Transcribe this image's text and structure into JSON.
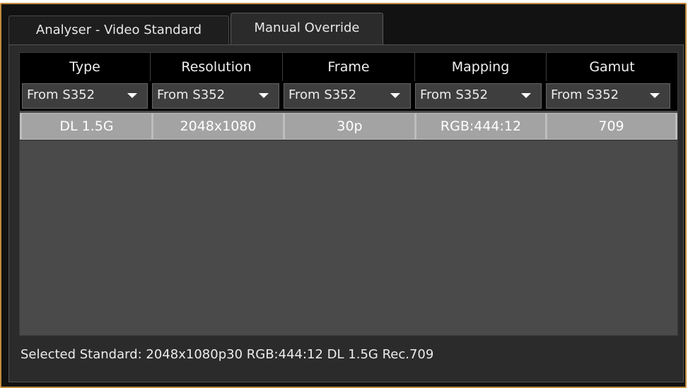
{
  "tabs": [
    {
      "label": "Analyser - Video Standard",
      "active": false
    },
    {
      "label": "Manual Override",
      "active": true
    }
  ],
  "table": {
    "columns": [
      "Type",
      "Resolution",
      "Frame",
      "Mapping",
      "Gamut"
    ],
    "dropdowns": [
      "From S352",
      "From S352",
      "From S352",
      "From S352",
      "From S352"
    ],
    "values": [
      "DL 1.5G",
      "2048x1080",
      "30p",
      "RGB:444:12",
      "709"
    ]
  },
  "status": {
    "text": "Selected Standard: 2048x1080p30 RGB:444:12 DL 1.5G Rec.709"
  },
  "colors": {
    "frame_border": "#c08a3c",
    "panel_bg": "#2b2b2b",
    "grid_bg": "#4a4a4a",
    "selected_row": "#a3a3a3"
  },
  "icons": {
    "dropdown": "chevron-down-icon"
  }
}
